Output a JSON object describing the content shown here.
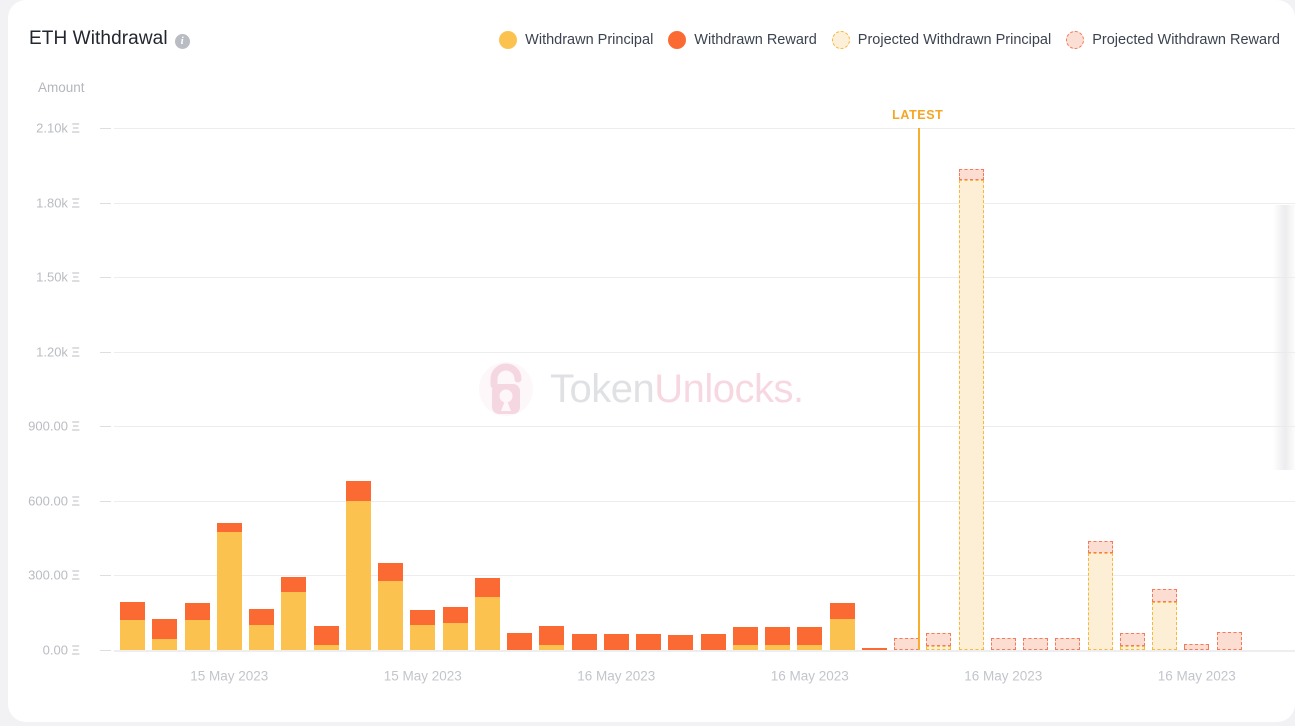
{
  "header": {
    "title": "ETH Withdrawal",
    "info_icon": "info-icon",
    "amount_axis_label": "Amount"
  },
  "legend": {
    "items": [
      {
        "label": "Withdrawn Principal",
        "swatch": "sw-principal",
        "color": "#FCC250"
      },
      {
        "label": "Withdrawn Reward",
        "swatch": "sw-reward",
        "color": "#FB6A33"
      },
      {
        "label": "Projected Withdrawn Principal",
        "swatch": "sw-proj-principal",
        "color": "#FDF0D9"
      },
      {
        "label": "Projected Withdrawn Reward",
        "swatch": "sw-proj-reward",
        "color": "#FBDFD5"
      }
    ]
  },
  "annotations": {
    "latest_label": "LATEST"
  },
  "watermark": {
    "text_primary": "Token",
    "text_secondary": "Unlocks.",
    "icon": "padlock-icon"
  },
  "chart_data": {
    "type": "bar",
    "title": "ETH Withdrawal",
    "subtype": "stacked",
    "xlabel": "",
    "ylabel": "Amount",
    "yunit": "Ξ",
    "ylim": [
      0,
      2250
    ],
    "grid": true,
    "legend_position": "top-right",
    "ytick_labels": [
      "2.10k Ξ",
      "1.80k Ξ",
      "1.50k Ξ",
      "1.20k Ξ",
      "900.00 Ξ",
      "600.00 Ξ",
      "300.00 Ξ",
      "0.00 Ξ"
    ],
    "ytick_values": [
      2100,
      1800,
      1500,
      1200,
      900,
      600,
      300,
      0
    ],
    "xtick_labels": [
      "15 May 2023",
      "15 May 2023",
      "16 May 2023",
      "16 May 2023",
      "16 May 2023",
      "16 May 2023"
    ],
    "xtick_indices": [
      3,
      9,
      15,
      21,
      27,
      33
    ],
    "latest_index": 24.35,
    "series": [
      {
        "name": "Withdrawn Principal",
        "key": "principal",
        "color": "#FCC250"
      },
      {
        "name": "Withdrawn Reward",
        "key": "reward",
        "color": "#FB6A33"
      },
      {
        "name": "Projected Withdrawn Principal",
        "key": "proj_principal",
        "color": "#FDEFD5"
      },
      {
        "name": "Projected Withdrawn Reward",
        "key": "proj_reward",
        "color": "#FBDDD2"
      }
    ],
    "bars": [
      {
        "index": 0,
        "projected": false,
        "principal": 120,
        "reward": 72
      },
      {
        "index": 1,
        "projected": false,
        "principal": 44,
        "reward": 80
      },
      {
        "index": 2,
        "projected": false,
        "principal": 122,
        "reward": 68
      },
      {
        "index": 3,
        "projected": false,
        "principal": 475,
        "reward": 38
      },
      {
        "index": 4,
        "projected": false,
        "principal": 100,
        "reward": 64
      },
      {
        "index": 5,
        "projected": false,
        "principal": 232,
        "reward": 60
      },
      {
        "index": 6,
        "projected": false,
        "principal": 22,
        "reward": 76
      },
      {
        "index": 7,
        "projected": false,
        "principal": 600,
        "reward": 80
      },
      {
        "index": 8,
        "projected": false,
        "principal": 278,
        "reward": 72
      },
      {
        "index": 9,
        "projected": false,
        "principal": 100,
        "reward": 62
      },
      {
        "index": 10,
        "projected": false,
        "principal": 108,
        "reward": 66
      },
      {
        "index": 11,
        "projected": false,
        "principal": 215,
        "reward": 74
      },
      {
        "index": 12,
        "projected": false,
        "principal": 2,
        "reward": 68
      },
      {
        "index": 13,
        "projected": false,
        "principal": 20,
        "reward": 78
      },
      {
        "index": 14,
        "projected": false,
        "principal": 2,
        "reward": 62
      },
      {
        "index": 15,
        "projected": false,
        "principal": 2,
        "reward": 62
      },
      {
        "index": 16,
        "projected": false,
        "principal": 2,
        "reward": 62
      },
      {
        "index": 17,
        "projected": false,
        "principal": 2,
        "reward": 58
      },
      {
        "index": 18,
        "projected": false,
        "principal": 2,
        "reward": 62
      },
      {
        "index": 19,
        "projected": false,
        "principal": 22,
        "reward": 70
      },
      {
        "index": 20,
        "projected": false,
        "principal": 22,
        "reward": 70
      },
      {
        "index": 21,
        "projected": false,
        "principal": 22,
        "reward": 70
      },
      {
        "index": 22,
        "projected": false,
        "principal": 124,
        "reward": 66
      },
      {
        "index": 23,
        "projected": false,
        "principal": 0,
        "reward": 6
      },
      {
        "index": 24,
        "projected": true,
        "proj_principal": 0,
        "proj_reward": 48
      },
      {
        "index": 25,
        "projected": true,
        "proj_principal": 18,
        "proj_reward": 52
      },
      {
        "index": 26,
        "projected": true,
        "proj_principal": 1890,
        "proj_reward": 45
      },
      {
        "index": 27,
        "projected": true,
        "proj_principal": 0,
        "proj_reward": 48
      },
      {
        "index": 28,
        "projected": true,
        "proj_principal": 0,
        "proj_reward": 48
      },
      {
        "index": 29,
        "projected": true,
        "proj_principal": 0,
        "proj_reward": 48
      },
      {
        "index": 30,
        "projected": true,
        "proj_principal": 390,
        "proj_reward": 50
      },
      {
        "index": 31,
        "projected": true,
        "proj_principal": 18,
        "proj_reward": 50
      },
      {
        "index": 32,
        "projected": true,
        "proj_principal": 195,
        "proj_reward": 52
      },
      {
        "index": 33,
        "projected": true,
        "proj_principal": 0,
        "proj_reward": 26
      },
      {
        "index": 34,
        "projected": true,
        "proj_principal": 0,
        "proj_reward": 72
      }
    ]
  }
}
